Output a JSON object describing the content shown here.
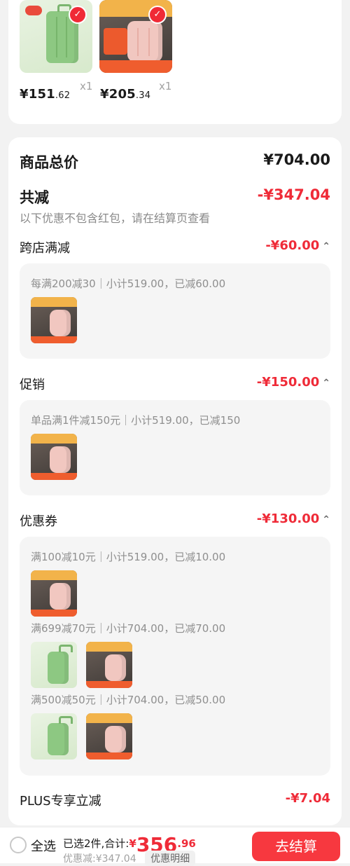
{
  "top_products": [
    {
      "price_main": "¥151",
      "price_decimal": ".62",
      "qty": "x1",
      "theme": "green"
    },
    {
      "price_main": "¥205",
      "price_decimal": ".34",
      "qty": "x1",
      "theme": "pink"
    }
  ],
  "summary": {
    "goods_total_label": "商品总价",
    "goods_total_value": "¥704.00",
    "discount_label": "共减",
    "discount_value": "-¥347.04",
    "discount_note": "以下优惠不包含红包，请在结算页查看"
  },
  "sections": [
    {
      "title": "跨店满减",
      "value": "-¥60.00",
      "rules": [
        {
          "text": "每满200减30｜小计519.00，已减60.00",
          "thumbs": [
            "pink"
          ]
        }
      ]
    },
    {
      "title": "促销",
      "value": "-¥150.00",
      "rules": [
        {
          "text": "单品满1件减150元｜小计519.00，已减150",
          "thumbs": [
            "pink"
          ]
        }
      ]
    },
    {
      "title": "优惠券",
      "value": "-¥130.00",
      "rules": [
        {
          "text": "满100减10元｜小计519.00，已减10.00",
          "thumbs": [
            "pink"
          ]
        },
        {
          "text": "满699减70元｜小计704.00，已减70.00",
          "thumbs": [
            "green",
            "pink"
          ]
        },
        {
          "text": "满500减50元｜小计704.00，已减50.00",
          "thumbs": [
            "green",
            "pink"
          ]
        }
      ]
    }
  ],
  "plus": {
    "label": "PLUS专享立减",
    "value": "-¥7.04"
  },
  "bottom_bar": {
    "select_all": "全选",
    "selected_text": "已选2件,合计:",
    "total_prefix": "¥",
    "total_main": "356",
    "total_decimal": ".96",
    "discount_text": "优惠减:¥347.04",
    "detail_label": "优惠明细",
    "checkout_label": "去结算"
  },
  "colors": {
    "accent": "#ef2b38",
    "button": "#f7383f",
    "background": "#f2f2f2"
  }
}
